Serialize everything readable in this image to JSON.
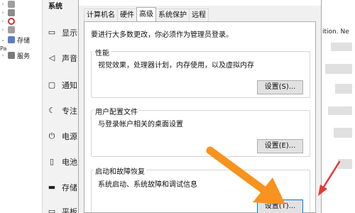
{
  "explorer": {
    "items": [
      {
        "icon": "drive-icon"
      },
      {
        "icon": "drive-icon"
      },
      {
        "icon": "forbidden-icon"
      },
      {
        "icon": "drive-icon"
      },
      {
        "label": "存储",
        "icon": "storage-icon"
      },
      {
        "label": "服务",
        "icon": "services-icon"
      }
    ],
    "side_text": "Pa"
  },
  "settings": {
    "title": "系统",
    "nav": [
      {
        "label": "显示",
        "icon": "monitor-icon"
      },
      {
        "label": "声音",
        "icon": "speaker-icon"
      },
      {
        "label": "通知",
        "icon": "notification-icon"
      },
      {
        "label": "专注",
        "icon": "moon-icon"
      },
      {
        "label": "电源",
        "icon": "power-icon"
      },
      {
        "label": "电池",
        "icon": "battery-icon"
      },
      {
        "label": "存储",
        "icon": "storage-icon"
      },
      {
        "label": "平板",
        "icon": "tablet-icon"
      }
    ]
  },
  "dialog": {
    "tabs": [
      "计算机名",
      "硬件",
      "高级",
      "系统保护",
      "远程"
    ],
    "active_tab": "高级",
    "admin_note": "要进行大多数更改，你必须作为管理员登录。",
    "groups": [
      {
        "title": "性能",
        "description": "视觉效果，处理器计划，内存使用，以及虚拟内存",
        "button": "设置(S)..."
      },
      {
        "title": "用户配置文件",
        "description": "与登录帐户相关的桌面设置",
        "button": "设置(E)..."
      },
      {
        "title": "启动和故障恢复",
        "description": "系统启动、系统故障和调试信息",
        "button": "设置(T)..."
      }
    ]
  },
  "background": {
    "right_fragment": "ition. Ne"
  },
  "colors": {
    "orange_arrow": "#f7931e",
    "red_arrow": "#e53935",
    "focus_blue": "#0078d7"
  }
}
